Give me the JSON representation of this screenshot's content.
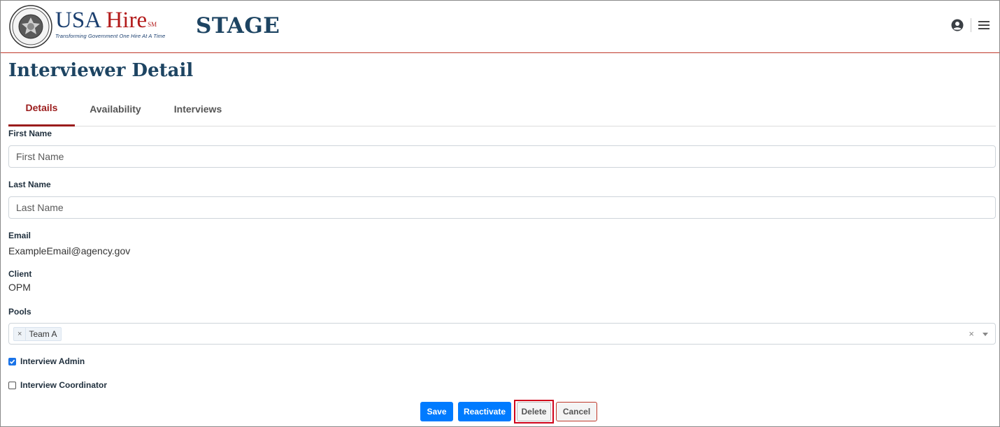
{
  "header": {
    "brand_name": "USA Hire",
    "brand_name_part1": "USA",
    "brand_name_part2": "Hire",
    "brand_mark": "SM",
    "brand_tagline": "Transforming Government One Hire At A Time",
    "environment": "STAGE",
    "icons": [
      "user-circle-icon",
      "hamburger-menu-icon"
    ],
    "accent_color": "#c0392b"
  },
  "page": {
    "title": "Interviewer Detail"
  },
  "tabs": [
    {
      "label": "Details",
      "active": true
    },
    {
      "label": "Availability",
      "active": false
    },
    {
      "label": "Interviews",
      "active": false
    }
  ],
  "form": {
    "first_name": {
      "label": "First Name",
      "value": "",
      "placeholder": "First Name"
    },
    "last_name": {
      "label": "Last Name",
      "value": "",
      "placeholder": "Last Name"
    },
    "email": {
      "label": "Email",
      "value": "ExampleEmail@agency.gov"
    },
    "client": {
      "label": "Client",
      "value": "OPM"
    },
    "pools": {
      "label": "Pools",
      "selected": [
        "Team A"
      ]
    },
    "interview_admin": {
      "label": "Interview Admin",
      "checked": true
    },
    "interview_coordinator": {
      "label": "Interview Coordinator",
      "checked": false
    }
  },
  "actions": {
    "save": "Save",
    "reactivate": "Reactivate",
    "delete": "Delete",
    "cancel": "Cancel"
  },
  "colors": {
    "primary": "#007bff",
    "title": "#1d4462",
    "active_tab": "#9b1c1c",
    "highlight": "#d0021b"
  }
}
